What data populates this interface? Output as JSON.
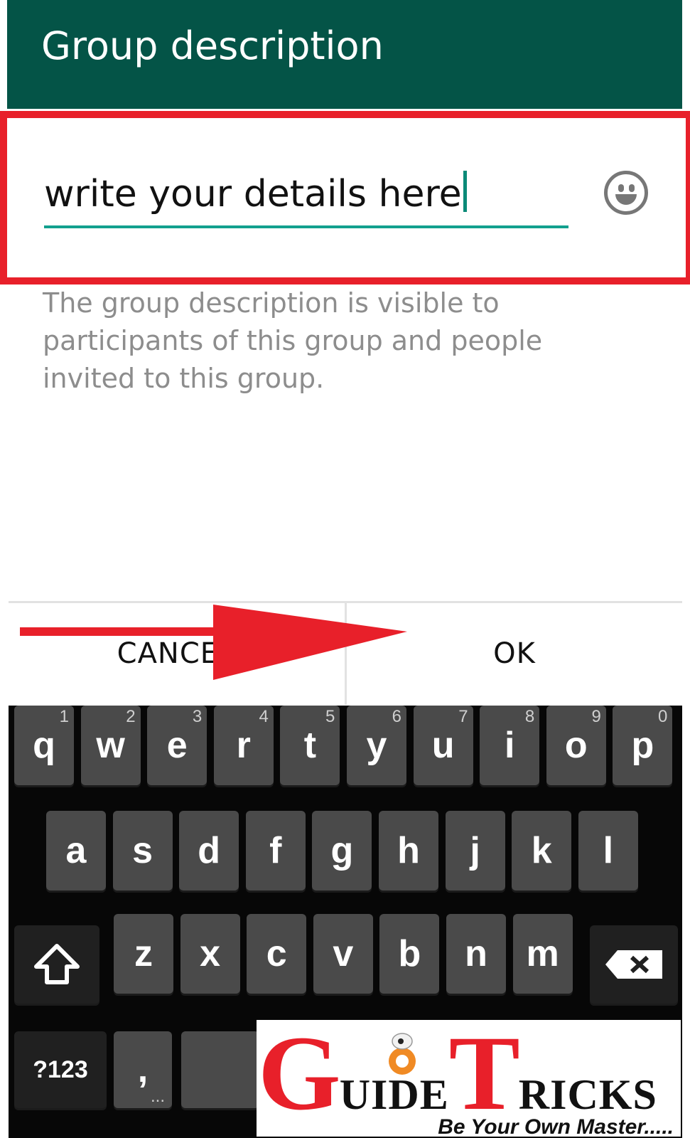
{
  "header": {
    "title": "Group description"
  },
  "description_input": {
    "value": "write your details here"
  },
  "helper_text": "The group description is visible to participants of this group and people invited to this group.",
  "dialog": {
    "cancel_label": "CANCEL",
    "ok_label": "OK"
  },
  "keyboard": {
    "row1": [
      {
        "label": "q",
        "hint": "1"
      },
      {
        "label": "w",
        "hint": "2"
      },
      {
        "label": "e",
        "hint": "3"
      },
      {
        "label": "r",
        "hint": "4"
      },
      {
        "label": "t",
        "hint": "5"
      },
      {
        "label": "y",
        "hint": "6"
      },
      {
        "label": "u",
        "hint": "7"
      },
      {
        "label": "i",
        "hint": "8"
      },
      {
        "label": "o",
        "hint": "9"
      },
      {
        "label": "p",
        "hint": "0"
      }
    ],
    "row2": [
      "a",
      "s",
      "d",
      "f",
      "g",
      "h",
      "j",
      "k",
      "l"
    ],
    "row3": [
      "z",
      "x",
      "c",
      "v",
      "b",
      "n",
      "m"
    ],
    "shift_icon": "shift-arrow-icon",
    "backspace_icon": "backspace-icon",
    "symbols_label": "?123",
    "comma_label": ",",
    "comma_hint": "..."
  },
  "watermark": {
    "brand": "GUIDE TRICKS",
    "tagline": "Be Your Own Master....."
  },
  "colors": {
    "header_bg": "#045447",
    "accent_teal": "#12a08e",
    "annotation_red": "#e8202a",
    "keyboard_bg": "#070707",
    "key_bg": "#4a4a4a"
  }
}
